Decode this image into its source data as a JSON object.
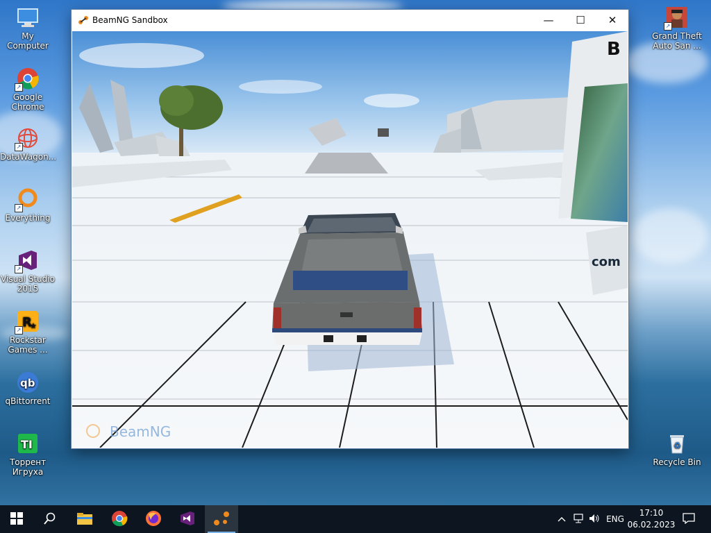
{
  "desktop": {
    "icons_left": [
      {
        "label": "My Computer",
        "icon": "computer-icon"
      },
      {
        "label": "Google Chrome",
        "icon": "chrome-icon"
      },
      {
        "label": "DataWagon...",
        "icon": "datawagon-icon"
      },
      {
        "label": "Everything",
        "icon": "everything-icon"
      },
      {
        "label": "Visual Studio 2015",
        "icon": "visual-studio-icon"
      },
      {
        "label": "Rockstar Games ...",
        "icon": "rockstar-icon"
      },
      {
        "label": "qBittorrent",
        "icon": "qbittorrent-icon"
      },
      {
        "label": "Торрент Игруха",
        "icon": "torrent-igruha-icon"
      }
    ],
    "icons_right": [
      {
        "label": "Grand Theft Auto San ...",
        "icon": "gta-icon"
      },
      {
        "label": "Recycle Bin",
        "icon": "recycle-bin-icon"
      }
    ]
  },
  "window": {
    "title": "BeamNG Sandbox",
    "icon": "beamng-icon",
    "controls": {
      "minimize": "—",
      "maximize": "☐",
      "close": "✕"
    },
    "watermark": "BeamNG",
    "billboard_text": "com"
  },
  "taskbar": {
    "apps": [
      "windows-start-icon",
      "search-icon",
      "file-explorer-icon",
      "chrome-icon",
      "firefox-icon",
      "visual-studio-icon",
      "beamng-icon"
    ],
    "active_app": "beamng-icon",
    "tray": {
      "language": "ENG",
      "time": "17:10",
      "date": "06.02.2023"
    }
  },
  "colors": {
    "taskbar_bg": "#0d1620",
    "accent": "#79b3e8",
    "vs_purple": "#68217a"
  }
}
